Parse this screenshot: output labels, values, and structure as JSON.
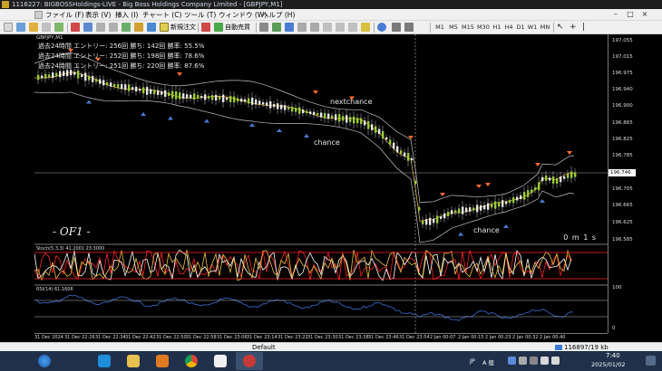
{
  "window": {
    "title": "1116227: BIGBOSSHoldings-LIVE - Big Boss Holdings Company Limited - [GBPJPY,M1]"
  },
  "menu": [
    "ファイル (F)",
    "表示 (V)",
    "挿入 (I)",
    "チャート (C)",
    "ツール (T)",
    "ウィンドウ (W)",
    "ヘルプ (H)"
  ],
  "toolbar": {
    "new_order_label": "新規注文",
    "autotrade_label": "自動売買",
    "timeframes": [
      "M1",
      "M5",
      "M15",
      "M30",
      "H1",
      "H4",
      "D1",
      "W1",
      "MN"
    ]
  },
  "chart": {
    "symbol_label": "GBPJPY,M1",
    "stats": [
      {
        "period": "過去24時間",
        "entries": "エントリー: 256回",
        "wins": "勝ち: 142回",
        "rate": "勝率: 55.5%"
      },
      {
        "period": "過去24時間",
        "entries": "エントリー: 252回",
        "wins": "勝ち: 198回",
        "rate": "勝率: 78.6%"
      },
      {
        "period": "過去24時間",
        "entries": "エントリー: 251回",
        "wins": "勝ち: 220回",
        "rate": "勝率: 87.6%"
      }
    ],
    "annotations": {
      "nextchance": "nextchance",
      "chance_1": "chance",
      "chance_2": "chance"
    },
    "watermark": "- OF1 -",
    "timer": "0 m 1 s",
    "current_price": "196.746",
    "price_ticks": [
      "197.055",
      "197.015",
      "196.975",
      "196.940",
      "196.900",
      "196.865",
      "196.825",
      "196.785",
      "196.746",
      "196.705",
      "196.665",
      "196.625",
      "196.585"
    ],
    "stoch_label": "Stoch(5,3,3) 41.2001 23.3000",
    "stoch_ticks": [
      "100",
      "0"
    ],
    "rsi_label": "RSI(14) 61.1606",
    "rsi_ticks": [
      "100",
      "0"
    ],
    "time_ticks": [
      "31 Dec 2024",
      "31 Dec 22:26",
      "31 Dec 22:34",
      "31 Dec 22:42",
      "31 Dec 22:50",
      "31 Dec 22:58",
      "31 Dec 23:06",
      "31 Dec 23:14",
      "31 Dec 23:22",
      "31 Dec 23:30",
      "31 Dec 23:38",
      "31 Dec 23:46",
      "31 Dec 23:54",
      "2 Jan 00:07",
      "2 Jan 00:15",
      "2 Jan 00:23",
      "2 Jan 00:32",
      "2 Jan 00:40"
    ],
    "colors": {
      "bull": "#9acd32",
      "bear": "#e8e8e8",
      "band": "#c0c0c0",
      "ma": "#f0c040",
      "up_arrow": "#4a7bd5",
      "down_arrow": "#ff6a2a",
      "stoch_main": "#ffffff",
      "stoch_signal": "#ff2020",
      "stoch_extra": "#f0c040",
      "rsi": "#3a6fd8"
    }
  },
  "status": {
    "profile": "Default",
    "connection": "116897/19 kb"
  },
  "taskbar": {
    "ime": "JP",
    "ime_mode": "A 般",
    "time": "7:40",
    "date": "2025/01/02"
  }
}
